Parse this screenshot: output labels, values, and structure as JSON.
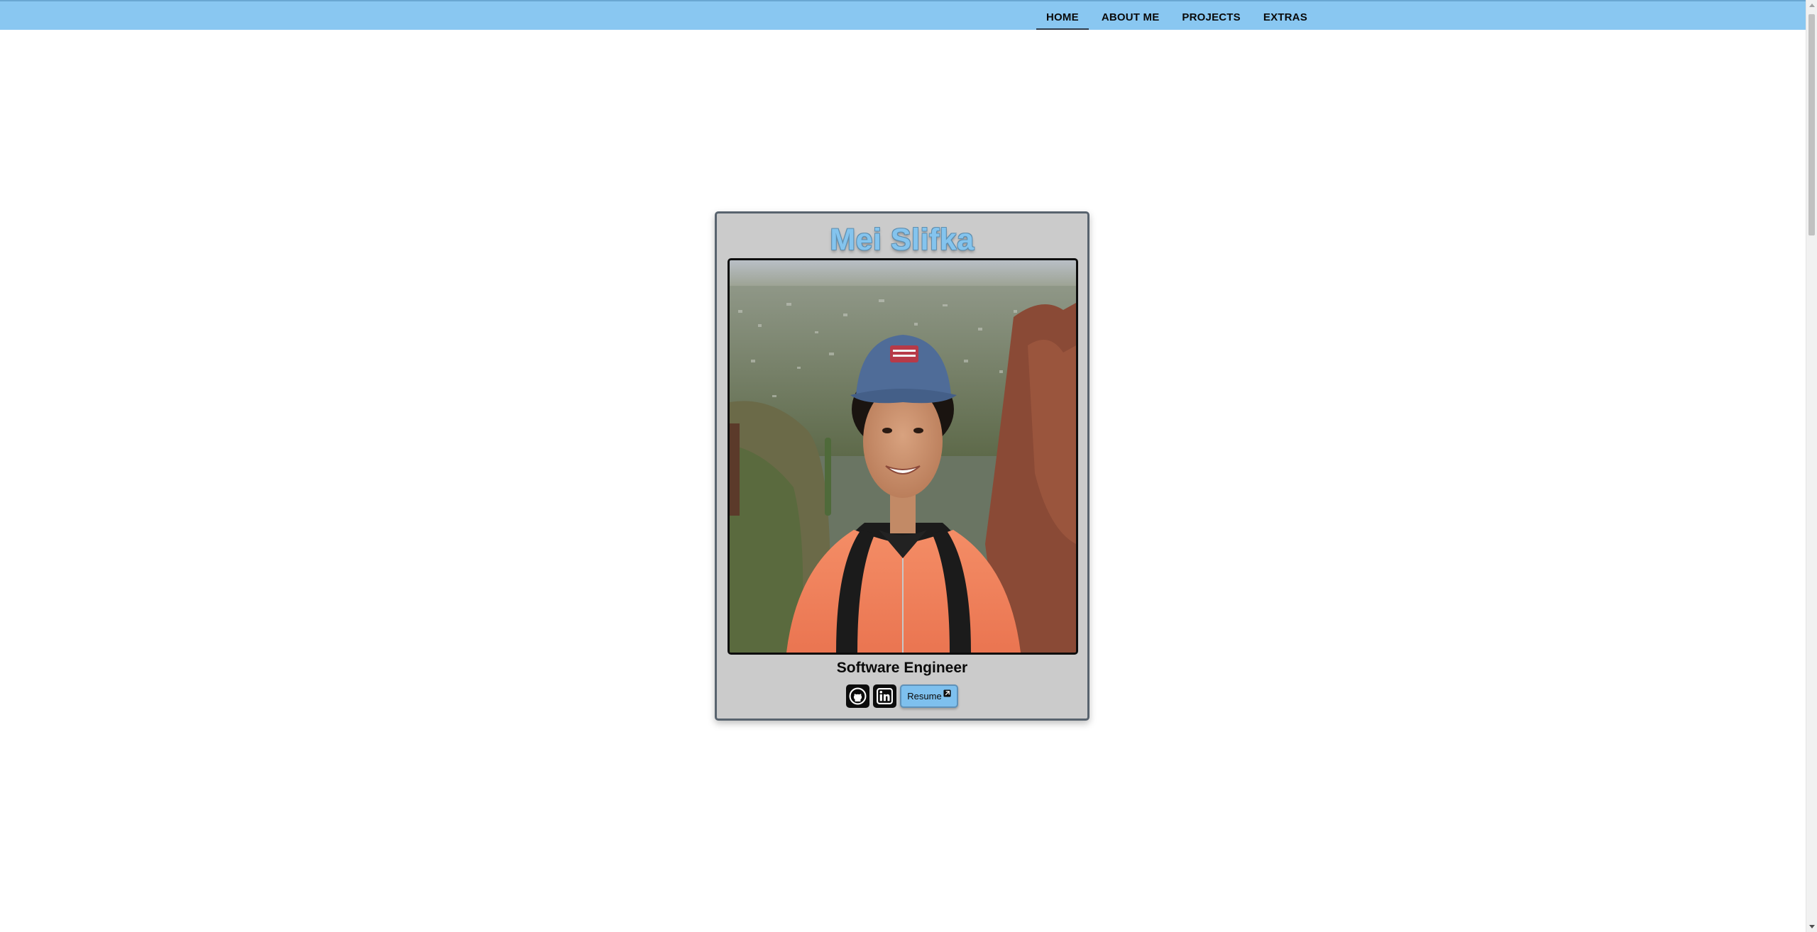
{
  "nav": {
    "items": [
      {
        "label": "HOME",
        "active": true
      },
      {
        "label": "ABOUT ME",
        "active": false
      },
      {
        "label": "PROJECTS",
        "active": false
      },
      {
        "label": "EXTRAS",
        "active": false
      }
    ]
  },
  "profile": {
    "name": "Mei Slifka",
    "title": "Software Engineer",
    "photo_icon": "profile-photo",
    "links": {
      "github_icon": "github-icon",
      "linkedin_icon": "linkedin-icon",
      "resume_label": "Resume",
      "resume_icon": "external-link-icon"
    }
  },
  "colors": {
    "navbar": "#89c7f1",
    "card_background": "#cbcbcb",
    "card_border": "#58636e",
    "name_text": "#84c4ee",
    "resume_button": "#7ec0ee"
  }
}
